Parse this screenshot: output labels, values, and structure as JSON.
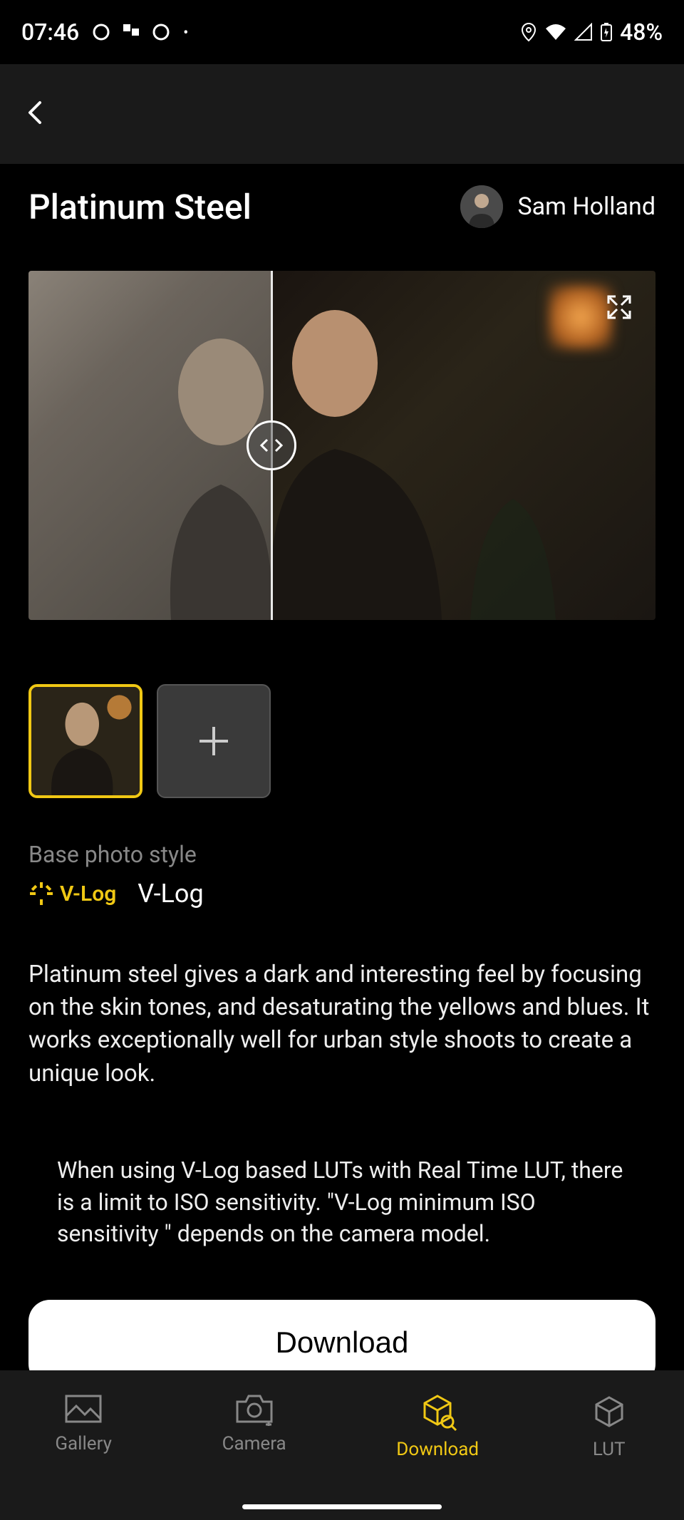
{
  "status": {
    "time": "07:46",
    "battery": "48%"
  },
  "header": {
    "lut_title": "Platinum Steel",
    "author_name": "Sam Holland"
  },
  "base_style": {
    "label": "Base photo style",
    "badge": "V-Log",
    "name": "V-Log"
  },
  "description": "Platinum steel gives a dark and interesting feel by focusing on the skin tones, and desaturating the yellows and blues. It works exceptionally well for urban style shoots to create a unique look.",
  "warning": "When using V-Log based LUTs with Real Time LUT, there is a limit to ISO sensitivity. \"V-Log minimum ISO sensitivity \" depends on the camera model.",
  "actions": {
    "download": "Download"
  },
  "nav": {
    "gallery": "Gallery",
    "camera": "Camera",
    "download": "Download",
    "lut": "LUT"
  }
}
